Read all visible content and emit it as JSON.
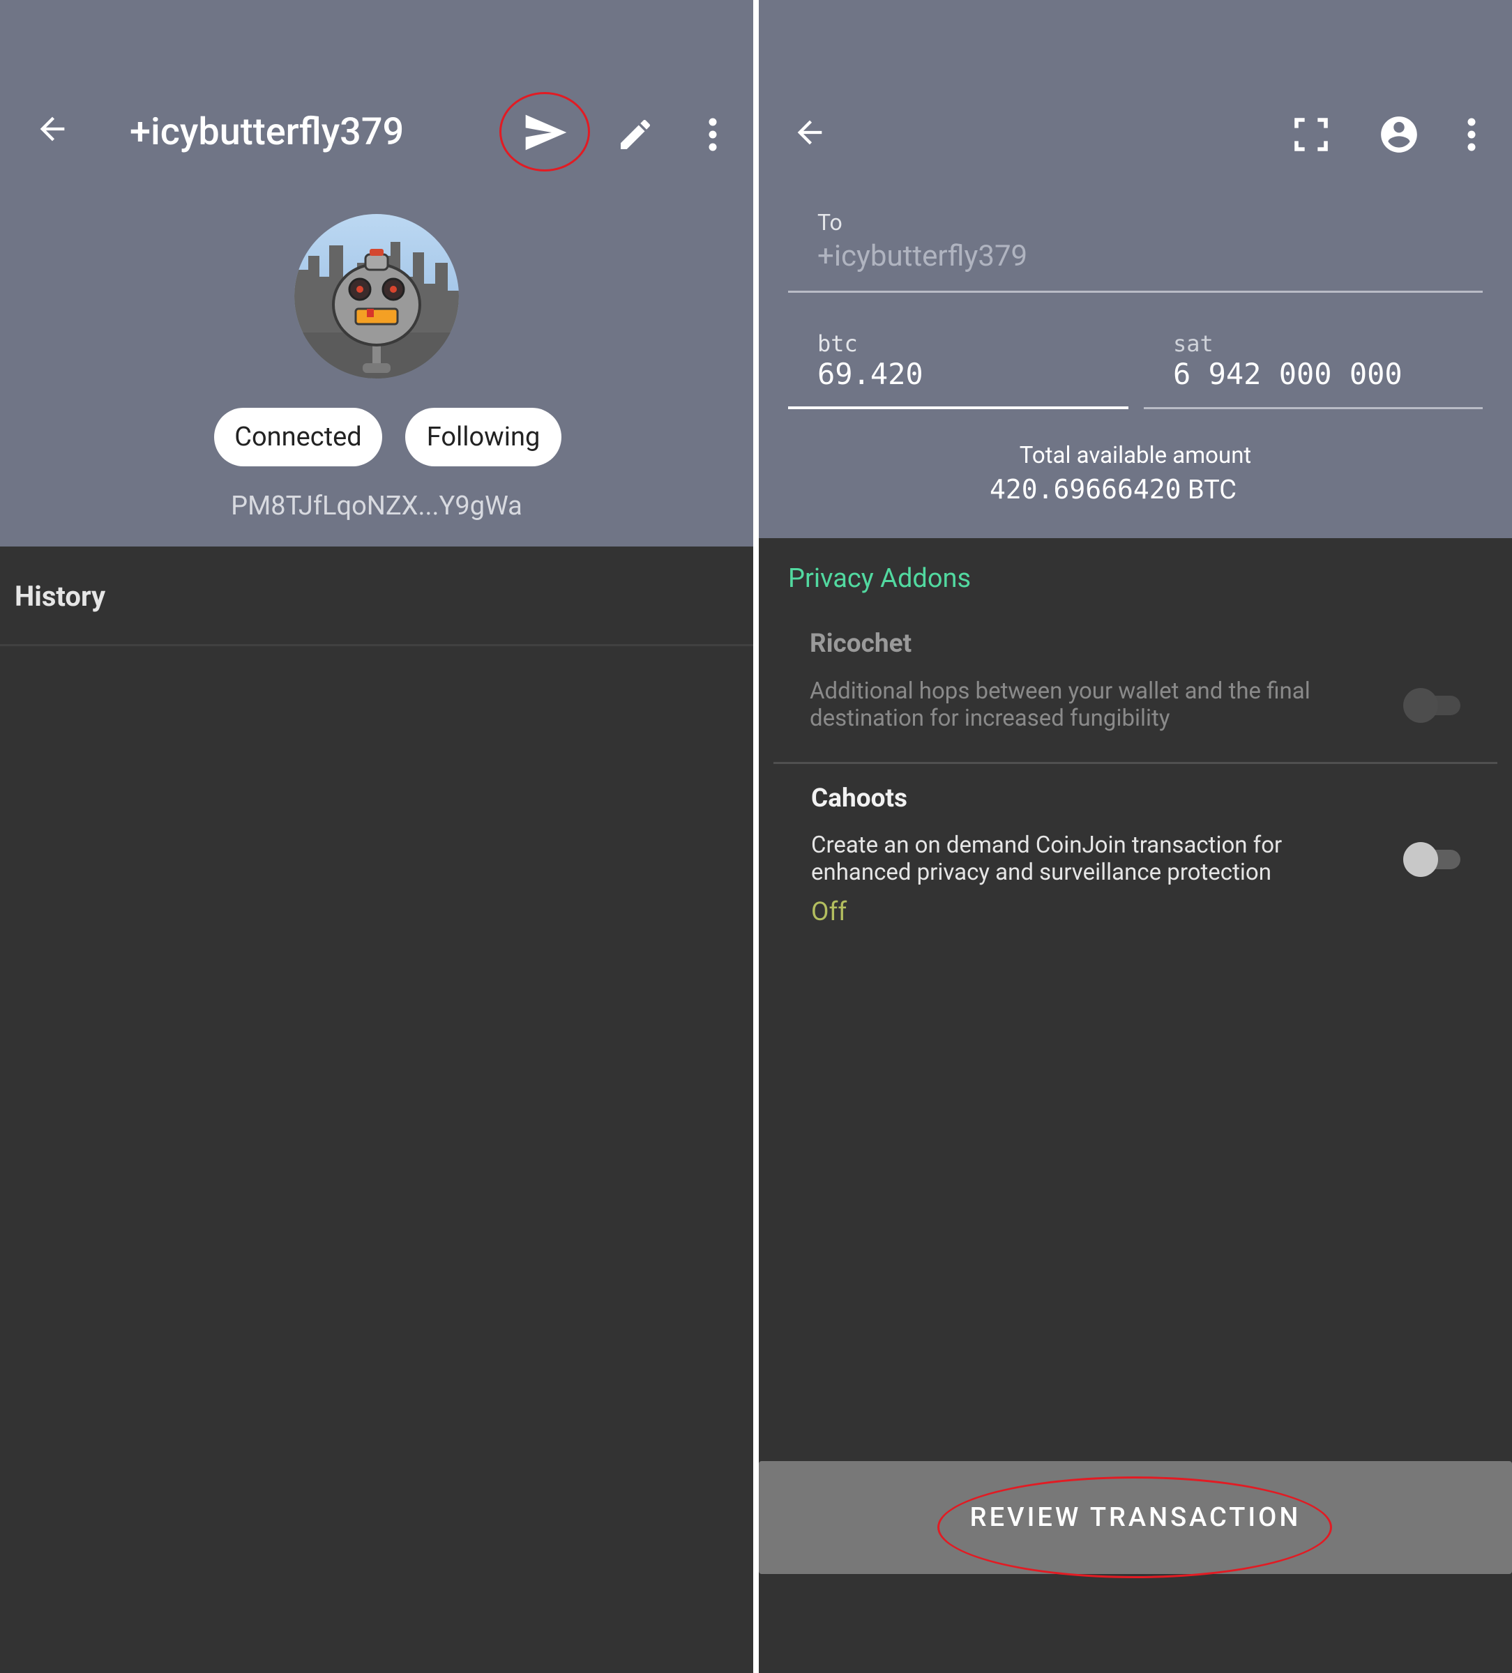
{
  "left": {
    "header": {
      "title": "+icybutterfly379",
      "icons": [
        "back-arrow-icon",
        "send-icon",
        "edit-pencil-icon",
        "more-vert-icon"
      ]
    },
    "chips": {
      "connected": "Connected",
      "following": "Following"
    },
    "paynym_code": "PM8TJfLqoNZX...Y9gWa",
    "history_label": "History"
  },
  "right": {
    "header": {
      "icons": [
        "back-arrow-icon",
        "scan-qr-icon",
        "account-circle-icon",
        "more-vert-icon"
      ]
    },
    "to": {
      "label": "To",
      "value": "+icybutterfly379"
    },
    "btc": {
      "label": "btc",
      "value": "69.420"
    },
    "sat": {
      "label": "sat",
      "value": "6 942 000 000"
    },
    "available": {
      "label": "Total available amount",
      "amount": "420.69666420",
      "unit": "BTC"
    },
    "privacy_addons_label": "Privacy Addons",
    "ricochet": {
      "title": "Ricochet",
      "description": "Additional hops between your wallet and the final destination for increased fungibility",
      "enabled": false
    },
    "cahoots": {
      "title": "Cahoots",
      "description": "Create an on demand CoinJoin transaction for enhanced privacy and surveillance protection",
      "status": "Off",
      "enabled": false
    },
    "review_button": "REVIEW TRANSACTION"
  },
  "colors": {
    "header_bg": "#707586",
    "body_bg": "#333333",
    "accent_green": "#52d9a0",
    "status_off": "#b3be5f",
    "button_bg": "#787878",
    "annotation_red": "#e21b23"
  }
}
